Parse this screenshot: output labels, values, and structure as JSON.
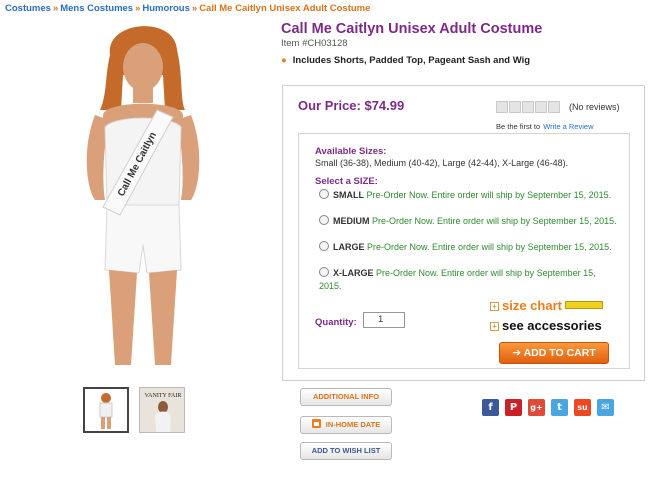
{
  "breadcrumb": {
    "items": [
      "Costumes",
      "Mens Costumes",
      "Humorous"
    ],
    "current": "Call Me Caitlyn Unisex Adult Costume",
    "separator": "»"
  },
  "product": {
    "title": "Call Me Caitlyn Unisex Adult Costume",
    "item_number": "Item #CH03128",
    "feature": "Includes Shorts, Padded Top, Pageant Sash and Wig",
    "sash_text": "Call Me Caitlyn",
    "thumbnail_text": "VANITY FAIR"
  },
  "pricing": {
    "price": "Our Price: $74.99",
    "no_reviews": "(No reviews)",
    "be_first": "Be the first to",
    "write_review": "Write a Review",
    "rating": 0,
    "rating_max": 5
  },
  "sizes": {
    "available_label": "Available Sizes:",
    "available_list": "Small (36-38), Medium (40-42), Large (42-44), X-Large (46-48).",
    "select_label": "Select a SIZE:",
    "options": [
      {
        "name": "SMALL",
        "note": "Pre-Order Now. Entire order will ship by September 15, 2015."
      },
      {
        "name": "MEDIUM",
        "note": "Pre-Order Now. Entire order will ship by September 15, 2015."
      },
      {
        "name": "LARGE",
        "note": "Pre-Order Now. Entire order will ship by September 15, 2015."
      },
      {
        "name": "X-LARGE",
        "note": "Pre-Order Now. Entire order will ship by September 15, 2015."
      }
    ]
  },
  "quantity": {
    "label": "Quantity:",
    "value": "1"
  },
  "links": {
    "size_chart": "size chart",
    "see_accessories": "see accessories"
  },
  "buttons": {
    "add_to_cart": "➔ ADD TO CART",
    "additional_info": "ADDITIONAL INFO",
    "in_home_date": "IN-HOME DATE",
    "wish_list": "ADD TO WISH LIST"
  },
  "social": [
    {
      "name": "facebook-icon",
      "glyph": "f",
      "color": "#3b5998"
    },
    {
      "name": "pinterest-icon",
      "glyph": "P",
      "color": "#cb2027"
    },
    {
      "name": "google-plus-icon",
      "glyph": "g+",
      "color": "#dd4b39"
    },
    {
      "name": "twitter-icon",
      "glyph": "t",
      "color": "#4aa6e0"
    },
    {
      "name": "stumbleupon-icon",
      "glyph": "su",
      "color": "#eb4924"
    },
    {
      "name": "email-icon",
      "glyph": "✉",
      "color": "#4aa6e0"
    }
  ]
}
